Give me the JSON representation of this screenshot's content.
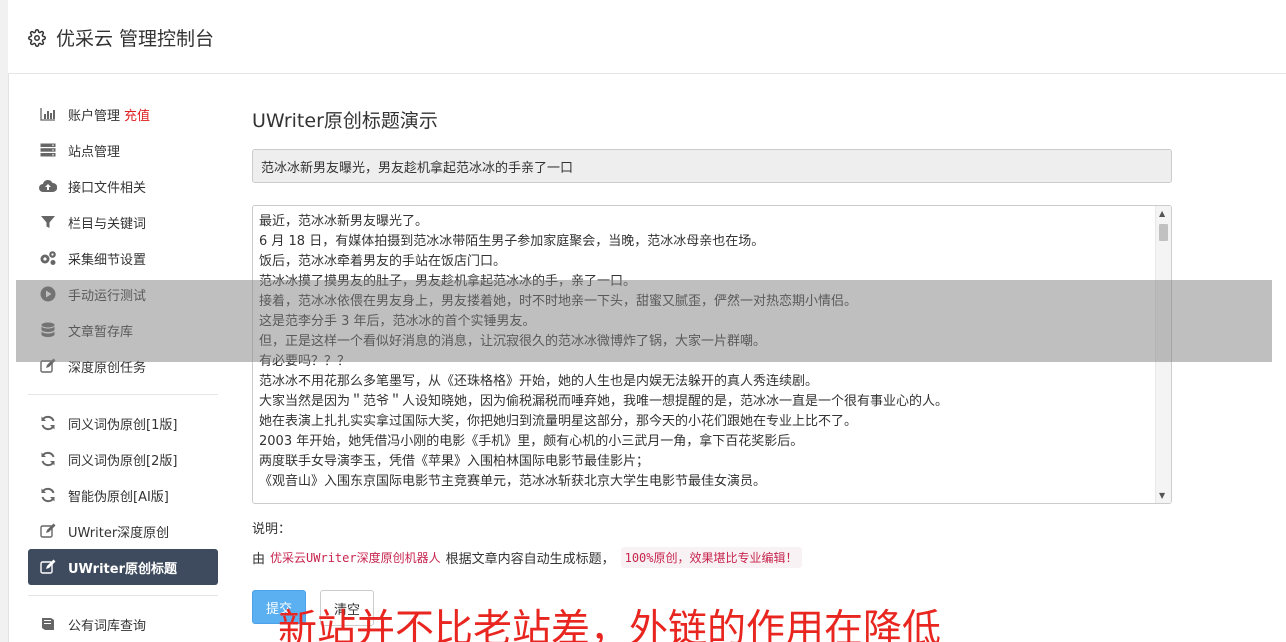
{
  "header": {
    "title": "优采云 管理控制台"
  },
  "sidebar": {
    "items": [
      {
        "label": "账户管理",
        "extra": "充值",
        "icon": "bar-chart-icon"
      },
      {
        "label": "站点管理",
        "icon": "server-icon"
      },
      {
        "label": "接口文件相关",
        "icon": "cloud-upload-icon"
      },
      {
        "label": "栏目与关键词",
        "icon": "filter-icon"
      },
      {
        "label": "采集细节设置",
        "icon": "gears-icon"
      },
      {
        "label": "手动运行测试",
        "icon": "play-circle-icon"
      },
      {
        "label": "文章暂存库",
        "icon": "database-icon"
      },
      {
        "label": "深度原创任务",
        "icon": "edit-icon"
      }
    ],
    "items2": [
      {
        "label": "同义词伪原创[1版]",
        "icon": "refresh-icon"
      },
      {
        "label": "同义词伪原创[2版]",
        "icon": "refresh-icon"
      },
      {
        "label": "智能伪原创[AI版]",
        "icon": "refresh-icon"
      },
      {
        "label": "UWriter深度原创",
        "icon": "edit-icon"
      },
      {
        "label": "UWriter原创标题",
        "icon": "edit-icon",
        "active": true
      }
    ],
    "items3": [
      {
        "label": "公有词库查询",
        "icon": "book-icon"
      }
    ]
  },
  "main": {
    "title": "UWriter原创标题演示",
    "title_value": "范冰冰新男友曝光，男友趁机拿起范冰冰的手亲了一口",
    "content_lines": [
      "最近，范冰冰新男友曝光了。",
      "6 月 18 日，有媒体拍摄到范冰冰带陌生男子参加家庭聚会，当晚，范冰冰母亲也在场。",
      "饭后，范冰冰牵着男友的手站在饭店门口。",
      "范冰冰摸了摸男友的肚子，男友趁机拿起范冰冰的手，亲了一口。",
      "接着，范冰冰依偎在男友身上，男友搂着她，时不时地亲一下头，甜蜜又腻歪，俨然一对热恋期小情侣。",
      "这是范李分手 3 年后，范冰冰的首个实锤男友。",
      "但，正是这样一个看似好消息的消息，让沉寂很久的范冰冰微博炸了锅，大家一片群嘲。",
      "有必要吗？？？",
      "范冰冰不用花那么多笔墨写，从《还珠格格》开始，她的人生也是内娱无法躲开的真人秀连续剧。",
      "大家当然是因为＂范爷＂人设知晓她，因为偷税漏税而唾弃她，我唯一想提醒的是，范冰冰一直是一个很有事业心的人。",
      "她在表演上扎扎实实拿过国际大奖，你把她归到流量明星这部分，那今天的小花们跟她在专业上比不了。",
      "2003 年开始，她凭借冯小刚的电影《手机》里，颇有心机的小三武月一角，拿下百花奖影后。",
      "两度联手女导演李玉，凭借《苹果》入围柏林国际电影节最佳影片；",
      "《观音山》入围东京国际电影节主竞赛单元，范冰冰斩获北京大学生电影节最佳女演员。"
    ],
    "explain_label": "说明：",
    "explain_prefix": "由",
    "explain_robot": "优采云UWriter深度原创机器人",
    "explain_mid": "根据文章内容自动生成标题，",
    "explain_badge": "100%原创，效果堪比专业编辑！",
    "submit_label": "提交",
    "clear_label": "清空"
  },
  "watermark": "新站并不比老站差，外链的作用在降低",
  "colors": {
    "active_bg": "#3e4b5e",
    "submit_bg": "#5bb0f2",
    "recharge": "#e02020",
    "watermark": "#e8251f"
  }
}
